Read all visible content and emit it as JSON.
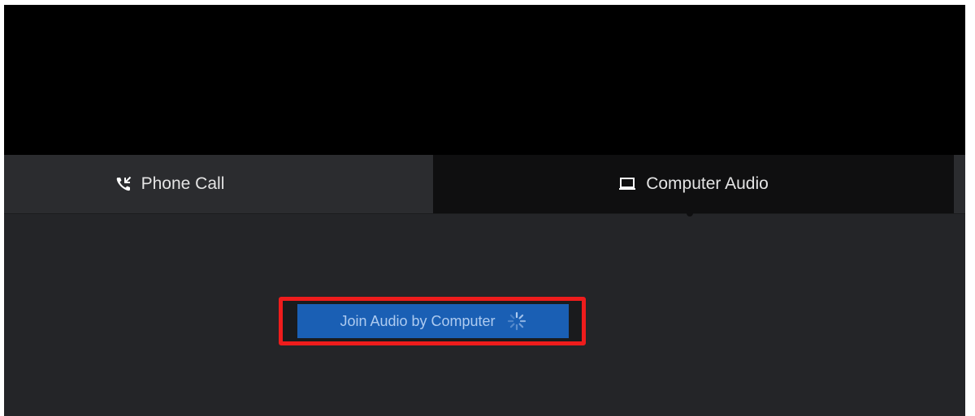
{
  "tabs": {
    "phone_call": {
      "label": "Phone Call",
      "icon": "phone-call-icon"
    },
    "computer_audio": {
      "label": "Computer Audio",
      "icon": "laptop-icon",
      "selected": true
    }
  },
  "join_button": {
    "label": "Join Audio by Computer",
    "icon": "loading-spinner-icon",
    "highlight_color": "#ee1c1c",
    "background_color": "#1a5fb4"
  }
}
